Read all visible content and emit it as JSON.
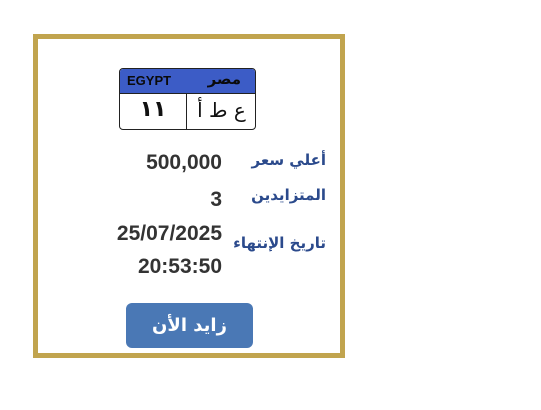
{
  "plate": {
    "country_en": "EGYPT",
    "country_ar": "مصر",
    "numbers": "١١",
    "letters": "ع ط أ"
  },
  "auction": {
    "highest_price_label": "أعلي سعر",
    "highest_price_value": "500,000",
    "bidders_label": "المتزايدين",
    "bidders_value": "3",
    "end_date_label": "تاريخ الإنتهاء",
    "end_date_value": "25/07/2025",
    "end_time_value": "20:53:50"
  },
  "actions": {
    "bid_label": "زايد الأن"
  },
  "colors": {
    "card_border": "#c1a44e",
    "plate_header": "#3c5cc6",
    "label_text": "#2b4a8c",
    "value_text": "#333333",
    "button_bg": "#4a78b5"
  }
}
